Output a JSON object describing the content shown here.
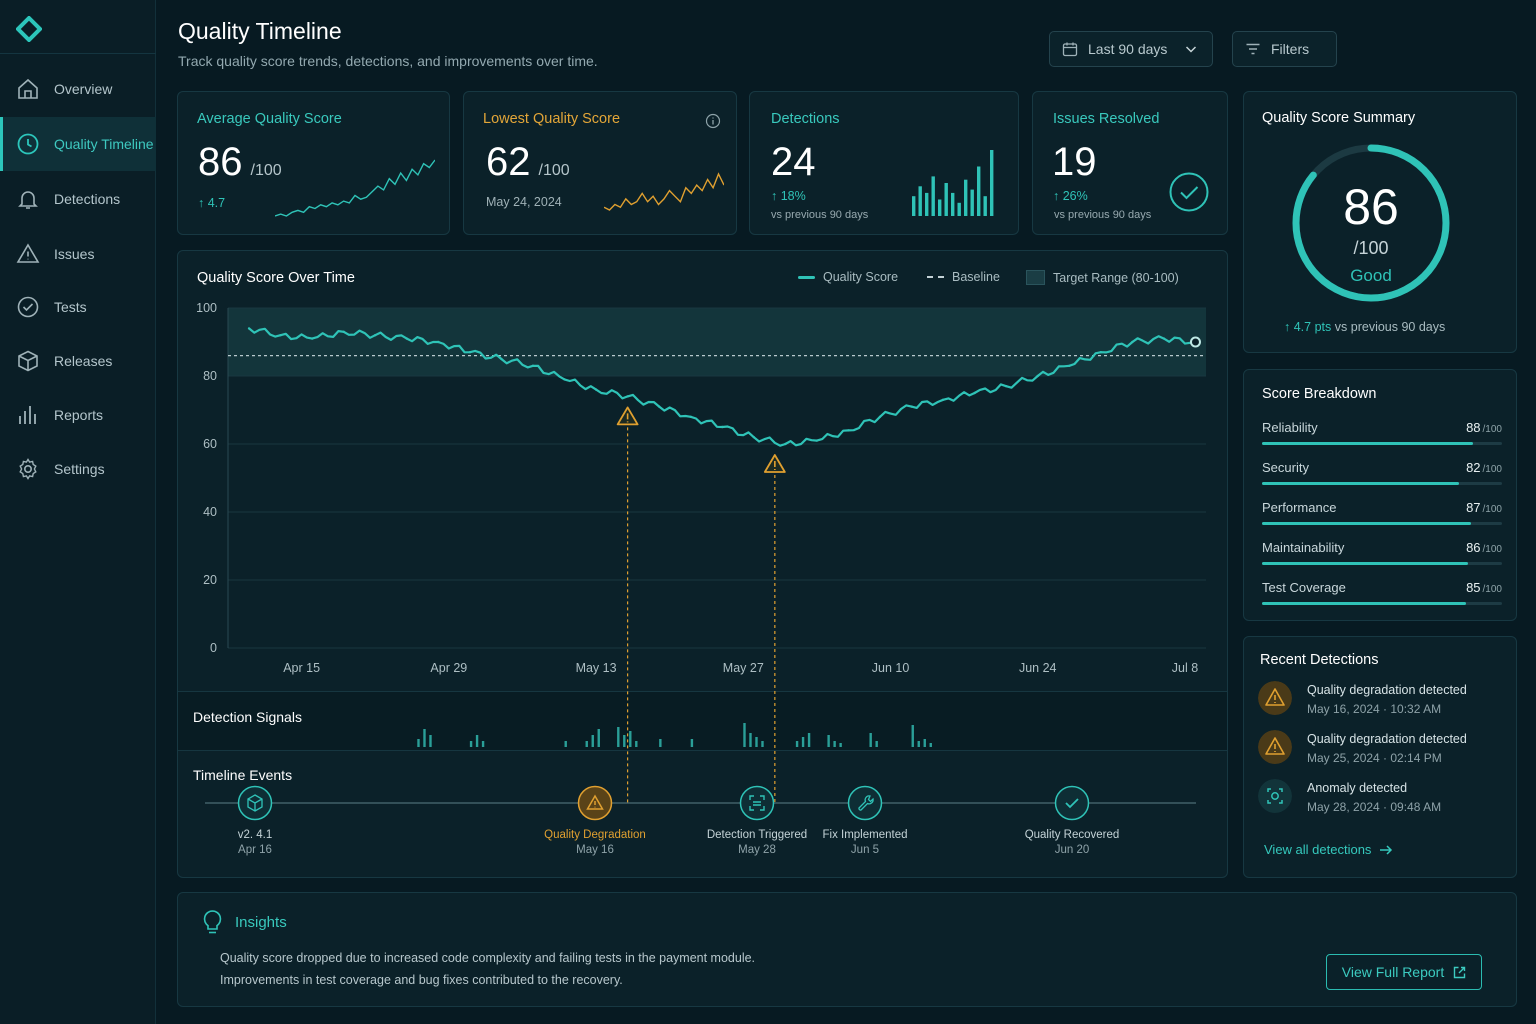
{
  "page": {
    "title": "Quality Timeline",
    "subtitle": "Track quality score trends, detections, and improvements over time."
  },
  "nav": [
    {
      "label": "Overview",
      "icon": "home-icon",
      "active": false
    },
    {
      "label": "Quality Timeline",
      "icon": "clock-icon",
      "active": true
    },
    {
      "label": "Detections",
      "icon": "bell-icon",
      "active": false
    },
    {
      "label": "Issues",
      "icon": "warning-icon",
      "active": false
    },
    {
      "label": "Tests",
      "icon": "check-circle-icon",
      "active": false
    },
    {
      "label": "Releases",
      "icon": "package-icon",
      "active": false
    },
    {
      "label": "Reports",
      "icon": "bar-chart-icon",
      "active": false
    },
    {
      "label": "Settings",
      "icon": "gear-icon",
      "active": false
    }
  ],
  "toolbar": {
    "date_range": "Last 90 days",
    "filters": "Filters"
  },
  "kpis": {
    "avg": {
      "label": "Average Quality Score",
      "value": "86",
      "unit": "/100",
      "delta": "4.7"
    },
    "lowest": {
      "label": "Lowest Quality Score",
      "value": "62",
      "unit": "/100",
      "date": "May 24, 2024"
    },
    "detections": {
      "label": "Detections",
      "value": "24",
      "delta": "18%",
      "sub": "vs previous 90 days"
    },
    "resolved": {
      "label": "Issues Resolved",
      "value": "19",
      "delta": "26%",
      "sub": "vs previous 90 days"
    }
  },
  "summary": {
    "title": "Quality Score Summary",
    "score": "86",
    "unit": "/100",
    "rating": "Good",
    "score_fraction": 0.86,
    "delta_value": "4.7",
    "delta_unit": "pts",
    "delta_text": "vs previous 90 days"
  },
  "breakdown": {
    "title": "Score Breakdown",
    "items": [
      {
        "name": "Reliability",
        "value": "88",
        "unit": "/100",
        "fraction": 0.88
      },
      {
        "name": "Security",
        "value": "82",
        "unit": "/100",
        "fraction": 0.82
      },
      {
        "name": "Performance",
        "value": "87",
        "unit": "/100",
        "fraction": 0.87
      },
      {
        "name": "Maintainability",
        "value": "86",
        "unit": "/100",
        "fraction": 0.86
      },
      {
        "name": "Test Coverage",
        "value": "85",
        "unit": "/100",
        "fraction": 0.85
      }
    ]
  },
  "detections": {
    "title": "Recent Detections",
    "items": [
      {
        "title": "Quality degradation detected",
        "time": "May 16, 2024 · 10:32 AM",
        "kind": "warning"
      },
      {
        "title": "Quality degradation detected",
        "time": "May 25, 2024 · 02:14 PM",
        "kind": "warning"
      },
      {
        "title": "Anomaly detected",
        "time": "May 28, 2024 · 09:48 AM",
        "kind": "anomaly"
      }
    ],
    "view_all": "View all detections"
  },
  "chart": {
    "title": "Quality Score Over Time",
    "legend": {
      "score": "Quality Score",
      "baseline": "Baseline",
      "target": "Target Range (80-100)"
    },
    "signals_label": "Detection Signals",
    "events_label": "Timeline Events"
  },
  "events": [
    {
      "label": "v2. 4.1",
      "date": "Apr 16",
      "icon": "package-icon",
      "kind": "release"
    },
    {
      "label": "Quality Degradation",
      "date": "May 16",
      "icon": "warning-icon",
      "kind": "warning"
    },
    {
      "label": "Detection Triggered",
      "date": "May 28",
      "icon": "scan-icon",
      "kind": "detection"
    },
    {
      "label": "Fix Implemented",
      "date": "Jun 5",
      "icon": "wrench-icon",
      "kind": "fix"
    },
    {
      "label": "Quality Recovered",
      "date": "Jun 20",
      "icon": "check-icon",
      "kind": "recovered"
    }
  ],
  "insights": {
    "title": "Insights",
    "line1": "Quality score dropped due to increased code complexity and failing tests in the payment module.",
    "line2": "Improvements in test coverage and bug fixes contributed to the recovery.",
    "button": "View Full Report"
  },
  "chart_data": {
    "type": "line",
    "x_ticks": [
      "Apr 15",
      "Apr 29",
      "May 13",
      "May 27",
      "Jun 10",
      "Jun 24",
      "Jul 8"
    ],
    "y_ticks": [
      0,
      20,
      40,
      60,
      80,
      100
    ],
    "ylim": [
      0,
      100
    ],
    "grid": true,
    "target_range": [
      80,
      100
    ],
    "baseline": 86,
    "series": [
      {
        "name": "Quality Score",
        "x": [
          "Apr 10",
          "Apr 13",
          "Apr 16",
          "Apr 19",
          "Apr 22",
          "Apr 25",
          "Apr 28",
          "May 1",
          "May 4",
          "May 7",
          "May 10",
          "May 13",
          "May 16",
          "May 19",
          "May 22",
          "May 25",
          "May 28",
          "May 31",
          "Jun 3",
          "Jun 6",
          "Jun 9",
          "Jun 12",
          "Jun 15",
          "Jun 18",
          "Jun 21",
          "Jun 24",
          "Jun 27",
          "Jun 30",
          "Jul 3",
          "Jul 6",
          "Jul 9"
        ],
        "values": [
          94,
          92,
          91,
          93,
          92,
          91,
          90,
          87,
          85,
          83,
          79,
          76,
          74,
          71,
          68,
          65,
          62,
          60,
          61,
          64,
          68,
          71,
          73,
          75,
          77,
          80,
          83,
          87,
          90,
          91,
          90
        ]
      }
    ],
    "markers": [
      {
        "x": "May 16",
        "y": 74,
        "kind": "warning"
      },
      {
        "x": "May 30",
        "y": 60,
        "kind": "warning"
      }
    ],
    "signals": [
      {
        "x": "Apr 26",
        "values": [
          0.4,
          0.9,
          0.6
        ]
      },
      {
        "x": "May 1",
        "values": [
          0.3,
          0.6,
          0.3
        ]
      },
      {
        "x": "May 10",
        "values": [
          0.3
        ]
      },
      {
        "x": "May 12",
        "values": [
          0.3,
          0.6,
          0.9
        ]
      },
      {
        "x": "May 15",
        "values": [
          1.0,
          0.6,
          0.8,
          0.3
        ]
      },
      {
        "x": "May 19",
        "values": [
          0.4
        ]
      },
      {
        "x": "May 22",
        "values": [
          0.4
        ]
      },
      {
        "x": "May 27",
        "values": [
          1.2,
          0.7,
          0.5,
          0.3
        ]
      },
      {
        "x": "Jun 1",
        "values": [
          0.3,
          0.5,
          0.7
        ]
      },
      {
        "x": "Jun 4",
        "values": [
          0.6,
          0.3,
          0.2
        ]
      },
      {
        "x": "Jun 8",
        "values": [
          0.7,
          0.3
        ]
      },
      {
        "x": "Jun 12",
        "values": [
          1.1,
          0.3,
          0.4,
          0.2
        ]
      }
    ]
  },
  "colors": {
    "accent": "#2fc3b7",
    "warning": "#e0a030",
    "background": "#071a22",
    "card": "#0b2129"
  }
}
